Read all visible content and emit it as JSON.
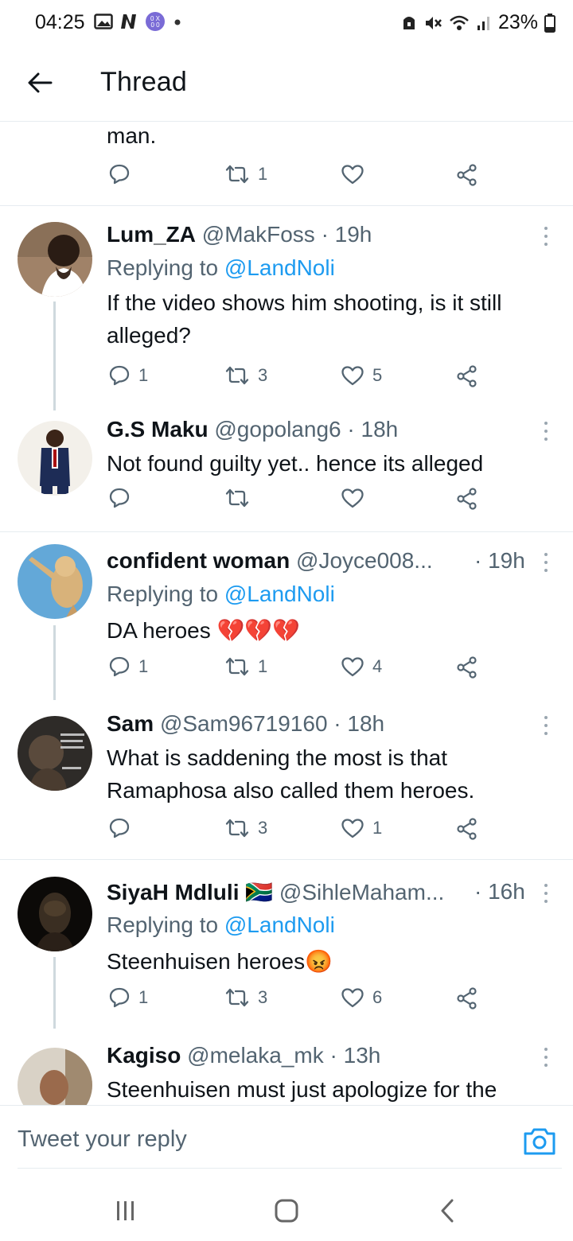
{
  "status_bar": {
    "time": "04:25",
    "battery": "23%",
    "left_icons": [
      "gallery-icon",
      "n-icon",
      "app-icon",
      "dot-icon"
    ],
    "right_icons": [
      "alarm-icon",
      "mute-icon",
      "wifi-icon",
      "signal-icon",
      "battery-icon"
    ]
  },
  "header": {
    "title": "Thread"
  },
  "cut_tweet": {
    "text": "man.",
    "retweets": "1"
  },
  "tweets": [
    {
      "name": "Lum_ZA",
      "handle": "@MakFoss",
      "time": "· 19h",
      "replying_prefix": "Replying to",
      "replying_handle": "@LandNoli",
      "text": "If the video shows him shooting, is it still alleged?",
      "replies": "1",
      "retweets": "3",
      "likes": "5"
    },
    {
      "name": "G.S Maku",
      "handle": "@gopolang6",
      "time": "· 18h",
      "text": "Not found guilty yet.. hence its alleged",
      "replies": "",
      "retweets": "",
      "likes": ""
    },
    {
      "name": "confident woman",
      "handle": "@Joyce008...",
      "time": "· 19h",
      "replying_prefix": "Replying to",
      "replying_handle": "@LandNoli",
      "text": "DA heroes 💔💔💔",
      "replies": "1",
      "retweets": "1",
      "likes": "4"
    },
    {
      "name": "Sam",
      "handle": "@Sam96719160",
      "time": "· 18h",
      "text": "What is saddening the most  is that Ramaphosa also called them heroes.",
      "replies": "",
      "retweets": "3",
      "likes": "1"
    },
    {
      "name": "SiyaH Mdluli",
      "flag": "🇿🇦",
      "handle": "@SihleMaham...",
      "time": "· 16h",
      "replying_prefix": "Replying to",
      "replying_handle": "@LandNoli",
      "text": "Steenhuisen heroes😡",
      "replies": "1",
      "retweets": "3",
      "likes": "6"
    },
    {
      "name": "Kagiso",
      "handle": "@melaka_mk",
      "time": "· 13h",
      "text": "Steenhuisen must just apologize for the"
    }
  ],
  "reply_bar": {
    "placeholder": "Tweet your reply"
  },
  "colors": {
    "accent": "#1d9bf0",
    "secondary_text": "#536471",
    "divider": "#e6ecf0"
  }
}
